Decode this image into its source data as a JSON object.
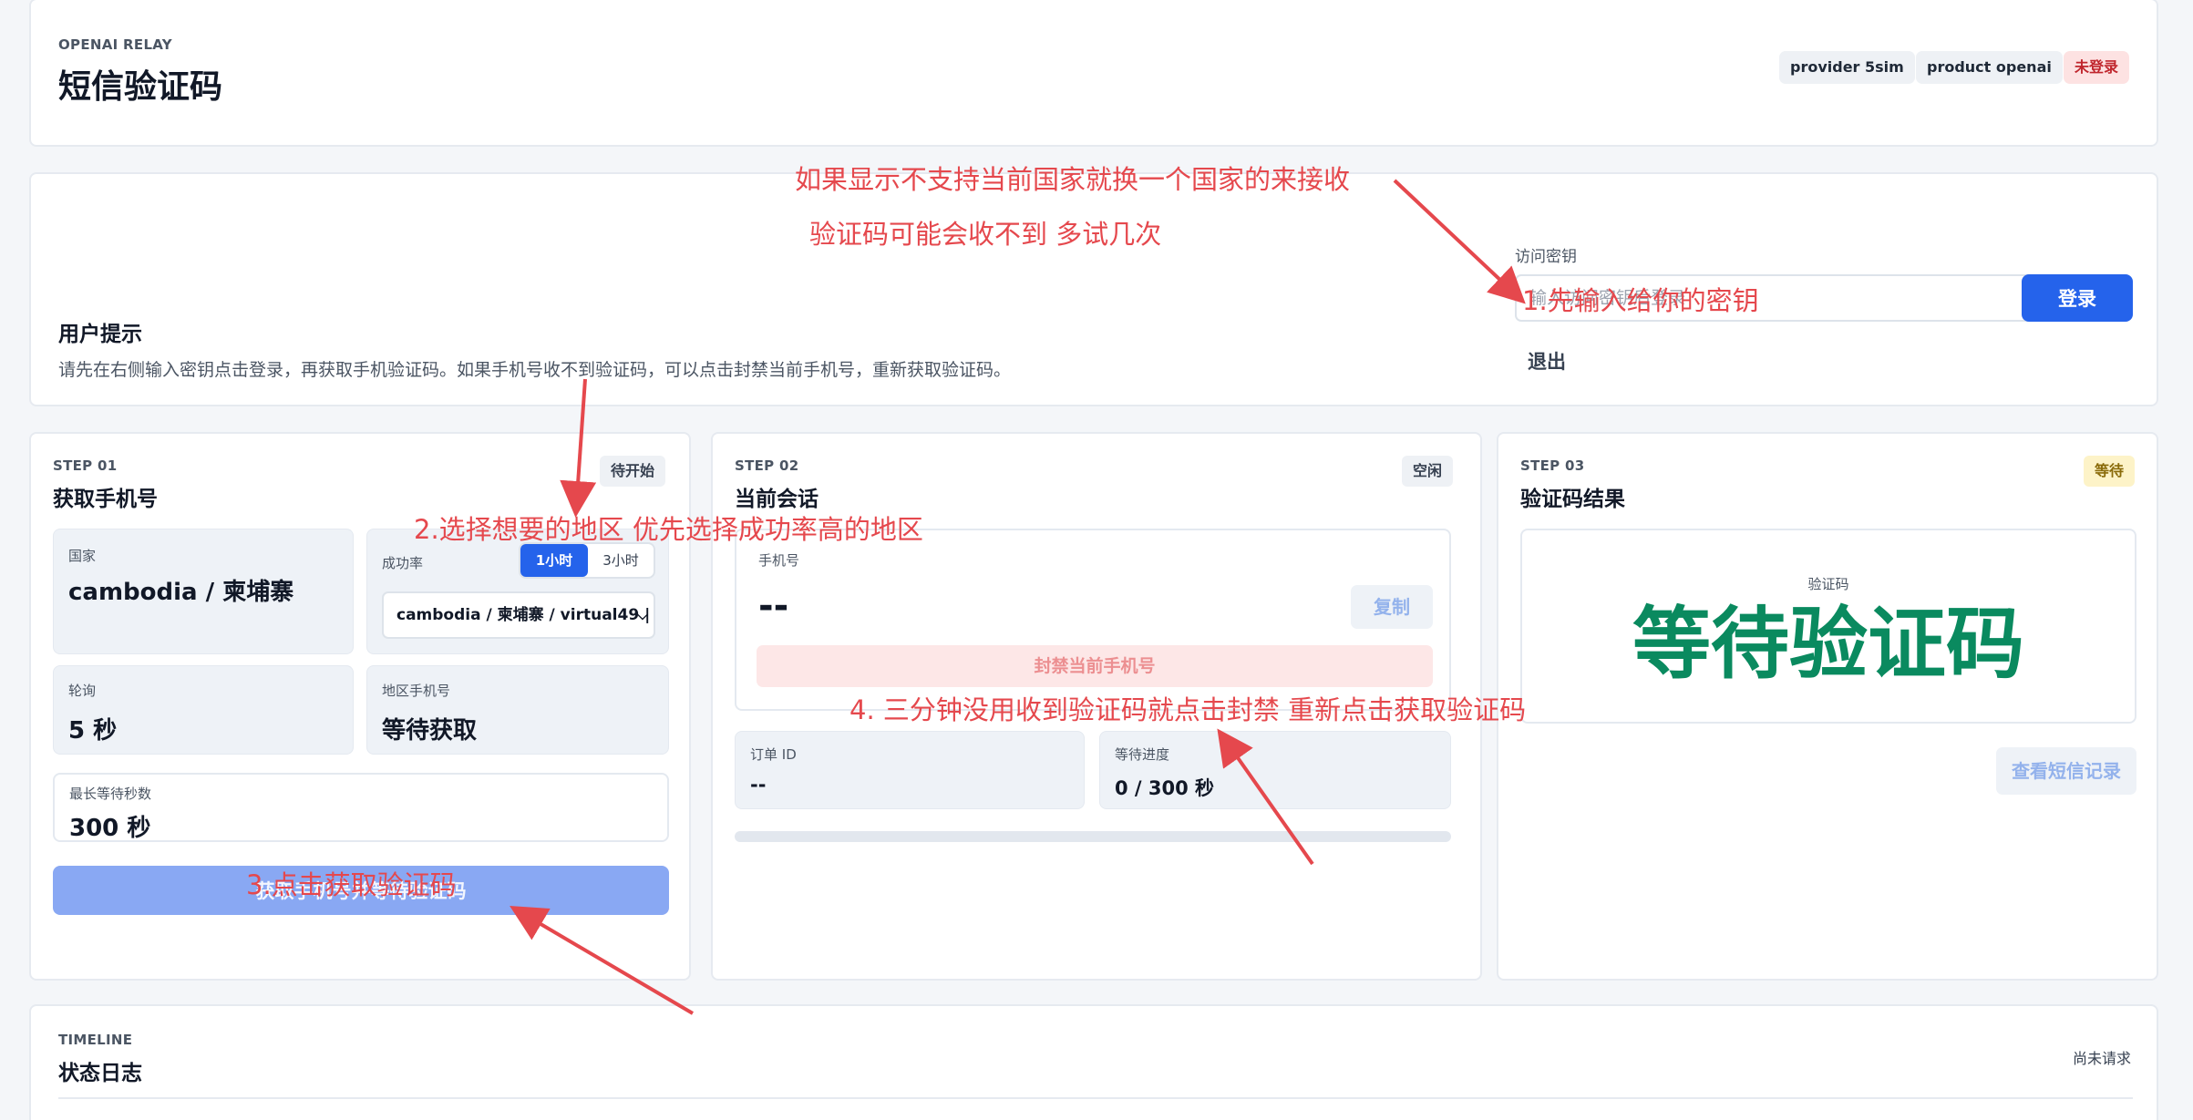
{
  "header": {
    "eyebrow": "OPENAI RELAY",
    "title": "短信验证码",
    "pills": {
      "provider": "provider 5sim",
      "product": "product openai",
      "login_status": "未登录"
    }
  },
  "tips": {
    "title": "用户提示",
    "text": "请先在右侧输入密钥点击登录，再获取手机验证码。如果手机号收不到验证码，可以点击封禁当前手机号，重新获取验证码。",
    "key_label": "访问密钥",
    "key_placeholder": "输入访问密钥后登录",
    "login_label": "登录",
    "logout_label": "退出"
  },
  "step1": {
    "eyebrow": "STEP 01",
    "title": "获取手机号",
    "status": "待开始",
    "country_label": "国家",
    "country_value": "cambodia / 柬埔寨",
    "rate_label": "成功率",
    "rate_tabs": [
      "1小时",
      "3小时"
    ],
    "route_value": "cambodia / 柬埔寨 / virtual49 |",
    "poll_label": "轮询",
    "poll_value": "5 秒",
    "region_phone_label": "地区手机号",
    "region_phone_value": "等待获取",
    "max_wait_label": "最长等待秒数",
    "max_wait_value": "300 秒",
    "get_button": "获取手机号并等待验证码"
  },
  "step2": {
    "eyebrow": "STEP 02",
    "title": "当前会话",
    "status": "空闲",
    "phone_label": "手机号",
    "phone_value": "--",
    "copy_label": "复制",
    "ban_label": "封禁当前手机号",
    "order_label": "订单 ID",
    "order_value": "--",
    "progress_label": "等待进度",
    "progress_value": "0 / 300 秒",
    "progress_fraction": 0
  },
  "step3": {
    "eyebrow": "STEP 03",
    "title": "验证码结果",
    "status": "等待",
    "code_label": "验证码",
    "code_value": "等待验证码",
    "history_label": "查看短信记录"
  },
  "timeline": {
    "eyebrow": "TIMELINE",
    "title": "状态日志",
    "status": "尚未请求"
  },
  "annotations": {
    "a1": "如果显示不支持当前国家就换一个国家的来接收",
    "a2": "验证码可能会收不到 多试几次",
    "a3": "1.先输入给你的密钥",
    "a4": "2.选择想要的地区 优先选择成功率高的地区",
    "a5": "4. 三分钟没用收到验证码就点击封禁 重新点击获取验证码",
    "a6": "3.点击获取验证码"
  },
  "colors": {
    "primary": "#2563eb",
    "annotation": "#e5484d",
    "code_green": "#0a8a5f",
    "danger_bg": "#fde2e2",
    "warn_bg": "#fdf3c8"
  }
}
